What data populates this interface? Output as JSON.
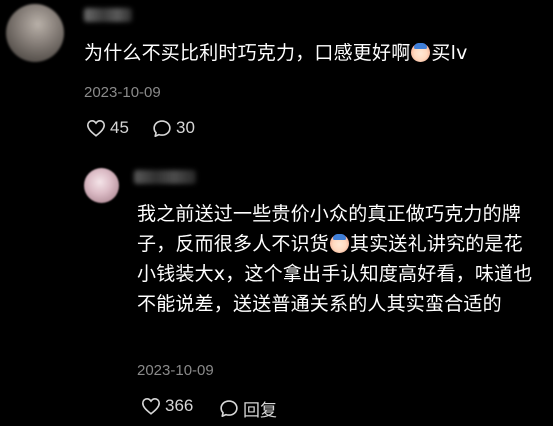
{
  "comments": [
    {
      "text_before_emoji": "为什么不买比利时巧克力，口感更好啊",
      "emoji_icon": "crying-face-emoji",
      "text_after_emoji": "买lv",
      "date": "2023-10-09",
      "likes": "45",
      "replies": "30"
    },
    {
      "text_part1": "我之前送过一些贵价小众的真正做巧克力的牌子，反而很多人不识货",
      "emoji_icon": "crying-face-emoji",
      "text_part2": "其实送礼讲究的是花小钱装大x，这个拿出手认知度高好看，味道也不能说差，送送普通关系的人其实蛮合适的",
      "date": "2023-10-09",
      "likes": "366",
      "reply_label": "回复"
    }
  ],
  "colors": {
    "background": "#000000",
    "text": "#ffffff",
    "meta": "#8a8a8a",
    "actions": "#d6d6d6"
  }
}
